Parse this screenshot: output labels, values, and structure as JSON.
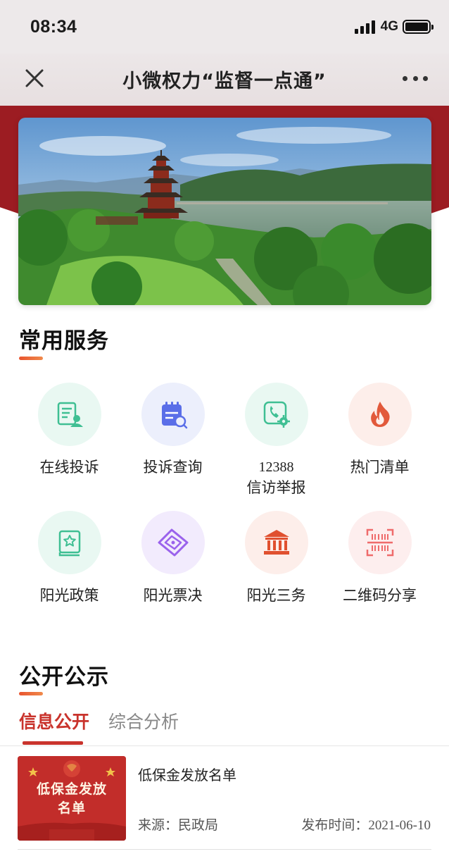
{
  "status_bar": {
    "time": "08:34",
    "network": "4G"
  },
  "nav": {
    "title": "小微权力“监督一点通”"
  },
  "common_services": {
    "title": "常用服务",
    "items": [
      {
        "label": "在线投诉",
        "icon": "complaint-form-icon",
        "color": "#3fbf93",
        "bg": "#e9f8f2"
      },
      {
        "label": "投诉查询",
        "icon": "calendar-search-icon",
        "color": "#5a6ee8",
        "bg": "#eceffc"
      },
      {
        "label_line1": "12388",
        "label_line2": "信访举报",
        "icon": "phone-gear-icon",
        "color": "#3fbf93",
        "bg": "#e9f8f2"
      },
      {
        "label": "热门清单",
        "icon": "flame-icon",
        "color": "#e2593b",
        "bg": "#fdeeea"
      },
      {
        "label": "阳光政策",
        "icon": "star-book-icon",
        "color": "#3fbf93",
        "bg": "#e9f8f2"
      },
      {
        "label": "阳光票决",
        "icon": "ticket-icon",
        "color": "#9a62ec",
        "bg": "#f2ebfd"
      },
      {
        "label": "阳光三务",
        "icon": "government-building-icon",
        "color": "#e0502f",
        "bg": "#fdeeea"
      },
      {
        "label": "二维码分享",
        "icon": "qr-scan-icon",
        "color": "#ef6b6b",
        "bg": "#fdeeee"
      }
    ]
  },
  "public_notice": {
    "title": "公开公示",
    "tabs": [
      {
        "label": "信息公开",
        "active": true
      },
      {
        "label": "综合分析",
        "active": false
      }
    ],
    "items": [
      {
        "thumbnail_text_line1": "低保金发放",
        "thumbnail_text_line2": "名单",
        "title": "低保金发放名单",
        "source_label": "来源：",
        "source": "民政局",
        "date_label": "发布时间：",
        "date": "2021-06-10"
      }
    ]
  },
  "colors": {
    "brand_red": "#9c1c22",
    "accent": "#c9332c",
    "underline_orange": "#e8542e"
  }
}
